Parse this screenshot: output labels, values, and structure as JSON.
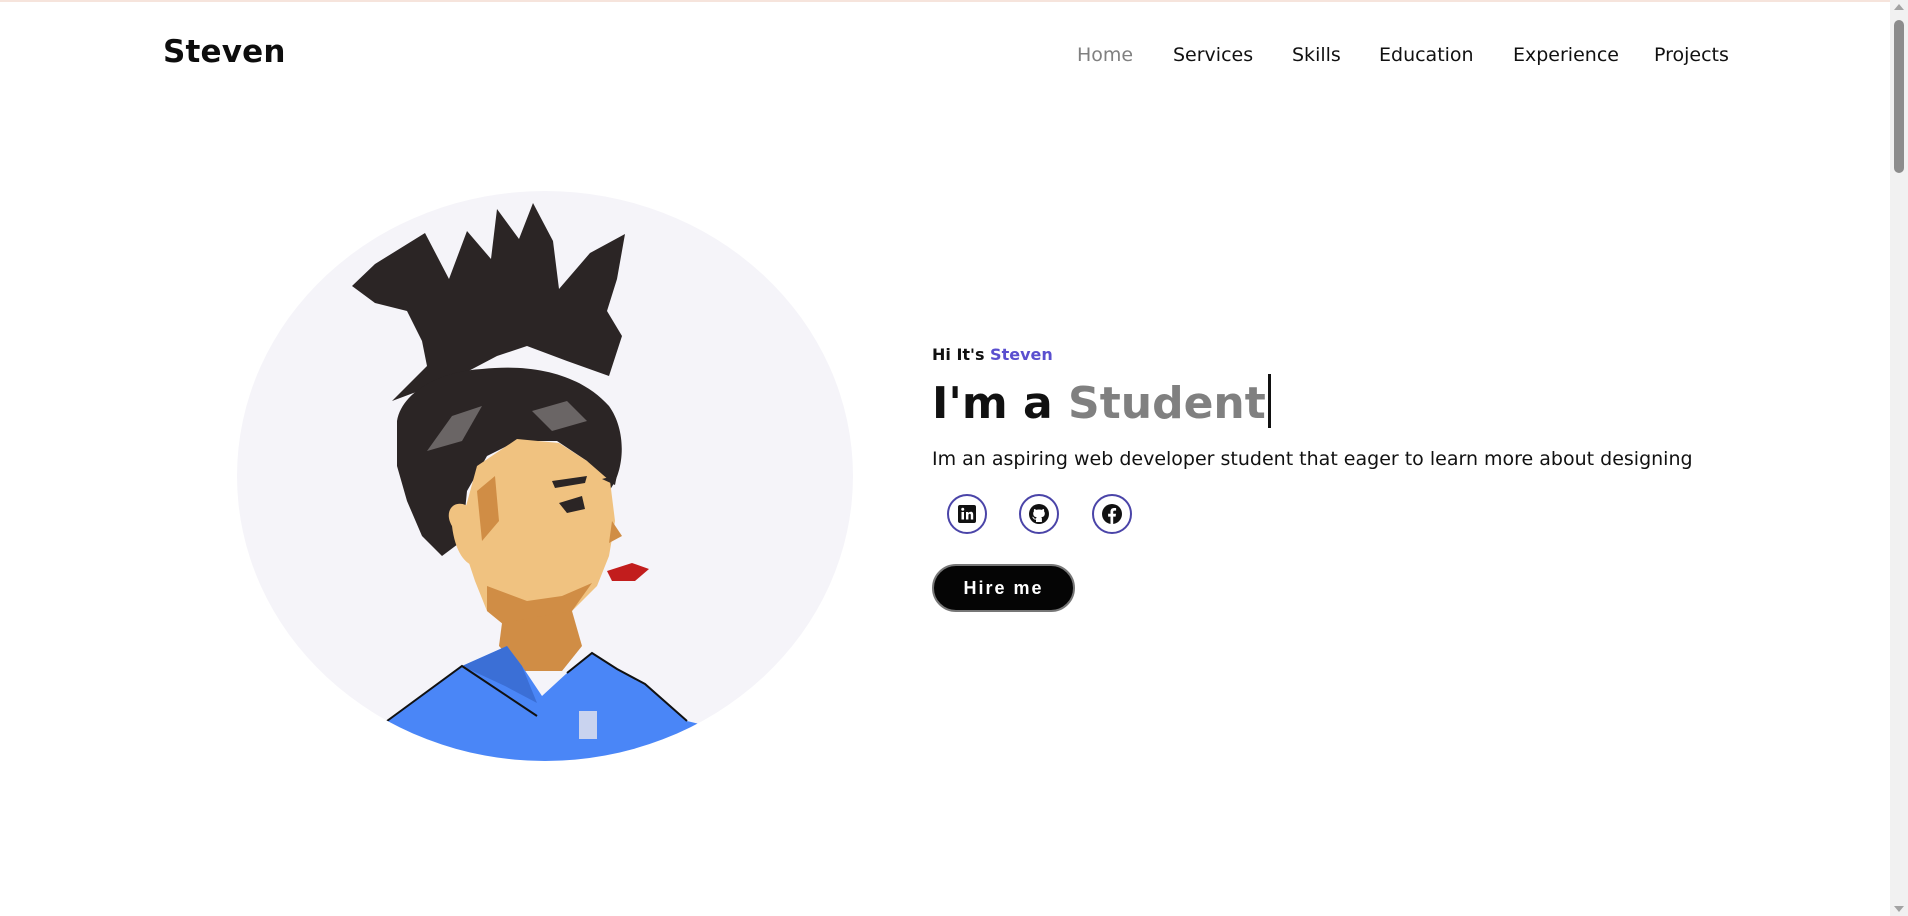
{
  "brand": {
    "name": "Steven"
  },
  "nav": {
    "items": [
      {
        "label": "Home",
        "active": true
      },
      {
        "label": "Services",
        "active": false
      },
      {
        "label": "Skills",
        "active": false
      },
      {
        "label": "Education",
        "active": false
      },
      {
        "label": "Experience",
        "active": false
      },
      {
        "label": "Projects",
        "active": false
      }
    ]
  },
  "hero": {
    "greeting_prefix": "Hi It's",
    "greeting_name": "Steven",
    "headline_prefix": "I'm a",
    "headline_typed": "Student",
    "description": "Im an aspiring web developer student that eager to learn more about designing",
    "socials": [
      {
        "icon": "linkedin-icon"
      },
      {
        "icon": "github-icon"
      },
      {
        "icon": "facebook-icon"
      }
    ],
    "cta_label": "Hire me"
  },
  "colors": {
    "accent": "#5a4fcf",
    "nav_active": "#808080",
    "button_bg": "#050505",
    "avatar_circle": "#f5f4f9",
    "shirt": "#4a86f7"
  }
}
